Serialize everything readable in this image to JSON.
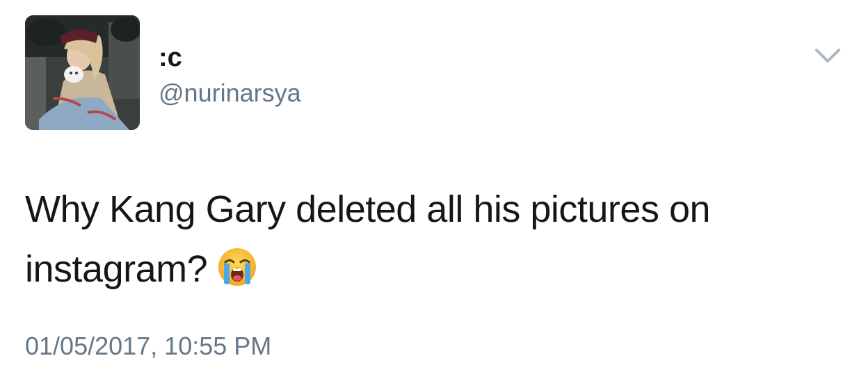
{
  "tweet": {
    "author": {
      "display_name": ":c",
      "handle": "@nurinarsya"
    },
    "text": "Why Kang Gary deleted all his pictures on instagram?",
    "emoji": "loudly-crying-face",
    "timestamp": "01/05/2017, 10:55 PM",
    "menu_icon": "chevron-down-icon"
  },
  "colors": {
    "text_primary": "#14171a",
    "text_secondary": "#657786",
    "caret": "#aab8c2",
    "background": "#ffffff"
  }
}
